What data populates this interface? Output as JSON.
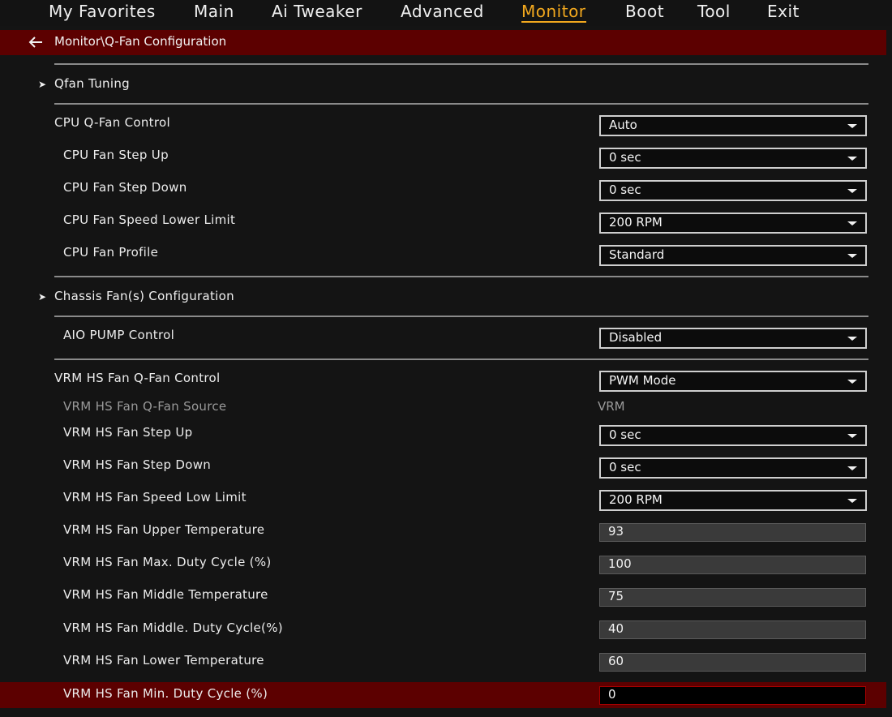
{
  "nav": {
    "tabs": [
      "My Favorites",
      "Main",
      "Ai Tweaker",
      "Advanced",
      "Monitor",
      "Boot",
      "Tool",
      "Exit"
    ],
    "active_tab": "Monitor"
  },
  "breadcrumb": {
    "text": "Monitor\\Q-Fan Configuration"
  },
  "submenus": {
    "qfan_tuning": "Qfan Tuning",
    "chassis_fans": "Chassis Fan(s) Configuration"
  },
  "cpu": {
    "qfan_control": {
      "label": "CPU Q-Fan Control",
      "value": "Auto"
    },
    "step_up": {
      "label": "CPU Fan Step Up",
      "value": "0 sec"
    },
    "step_down": {
      "label": "CPU Fan Step Down",
      "value": "0 sec"
    },
    "speed_lower_limit": {
      "label": "CPU Fan Speed Lower Limit",
      "value": "200 RPM"
    },
    "profile": {
      "label": "CPU Fan Profile",
      "value": "Standard"
    }
  },
  "aio": {
    "pump_control": {
      "label": "AIO PUMP Control",
      "value": "Disabled"
    }
  },
  "vrm": {
    "qfan_control": {
      "label": "VRM HS Fan Q-Fan Control",
      "value": "PWM Mode"
    },
    "qfan_source": {
      "label": "VRM HS Fan Q-Fan Source",
      "value": "VRM"
    },
    "step_up": {
      "label": "VRM HS Fan Step Up",
      "value": "0 sec"
    },
    "step_down": {
      "label": "VRM HS Fan Step Down",
      "value": "0 sec"
    },
    "speed_low_limit": {
      "label": "VRM HS Fan Speed Low Limit",
      "value": "200 RPM"
    },
    "upper_temp": {
      "label": "VRM HS Fan Upper Temperature",
      "value": "93"
    },
    "max_duty": {
      "label": "VRM HS Fan Max. Duty Cycle (%)",
      "value": "100"
    },
    "middle_temp": {
      "label": "VRM HS Fan Middle Temperature",
      "value": "75"
    },
    "middle_duty": {
      "label": "VRM HS Fan Middle. Duty Cycle(%)",
      "value": "40"
    },
    "lower_temp": {
      "label": "VRM HS Fan Lower Temperature",
      "value": "60"
    },
    "min_duty": {
      "label": "VRM HS Fan Min. Duty Cycle (%)",
      "value": "0"
    }
  },
  "colors": {
    "accent": "#f2a81e",
    "header_bar": "#5c0000",
    "background": "#141414"
  },
  "icons": {
    "back": "back-arrow-icon",
    "submenu": "submenu-arrow-icon",
    "dropdown": "chevron-down-icon"
  }
}
